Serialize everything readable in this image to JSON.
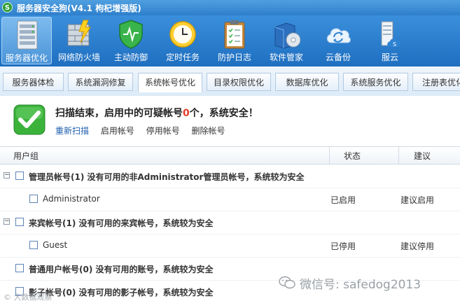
{
  "window": {
    "logo_text": "S",
    "title": "服务器安全狗(V4.1 枸杞增强版)"
  },
  "toolbar": {
    "items": [
      {
        "label": "服务器优化",
        "icon": "server-rack-icon"
      },
      {
        "label": "网络防火墙",
        "icon": "firewall-icon"
      },
      {
        "label": "主动防御",
        "icon": "shield-icon"
      },
      {
        "label": "定时任务",
        "icon": "clock-icon"
      },
      {
        "label": "防护日志",
        "icon": "clipboard-icon"
      },
      {
        "label": "软件管家",
        "icon": "software-box-icon"
      },
      {
        "label": "云备份",
        "icon": "cloud-sync-icon"
      },
      {
        "label": "服云",
        "icon": "cloud-server-icon"
      }
    ]
  },
  "tabs": [
    "服务器体检",
    "系统漏洞修复",
    "系统帐号优化",
    "目录权限优化",
    "数据库优化",
    "系统服务优化",
    "注册表优化"
  ],
  "summary": {
    "msg_before": "扫描结束，启用中的可疑帐号",
    "count": "0",
    "msg_after": "个，系统安全！",
    "actions": [
      "重新扫描",
      "启用帐号",
      "停用帐号",
      "删除帐号"
    ]
  },
  "table": {
    "headers": {
      "group": "用户组",
      "status": "状态",
      "advice": "建议"
    },
    "rows": [
      {
        "type": "group",
        "text": "管理员帐号(1)  没有可用的非Administrator管理员帐号，系统较为安全"
      },
      {
        "type": "item",
        "text": "Administrator",
        "status": "已启用",
        "advice": "建议启用"
      },
      {
        "type": "group",
        "text": "来宾帐号(1)  没有可用的来宾帐号，系统较为安全"
      },
      {
        "type": "item",
        "text": "Guest",
        "status": "已停用",
        "advice": "建议停用"
      },
      {
        "type": "group2",
        "text": "普通用户帐号(0)  没有可用的账号，系统较为安全"
      },
      {
        "type": "group2",
        "text": "影子帐号(0)  没有可用的影子帐号，系统较为安全"
      }
    ]
  },
  "watermark": {
    "text": "微信号: safedog2013",
    "corner": "© 大数据观察"
  },
  "colors": {
    "toolbar_blue": "#2f83d3",
    "link_blue": "#1f5fae",
    "alert_red": "#e23c2b",
    "check_green": "#3bb33b"
  }
}
